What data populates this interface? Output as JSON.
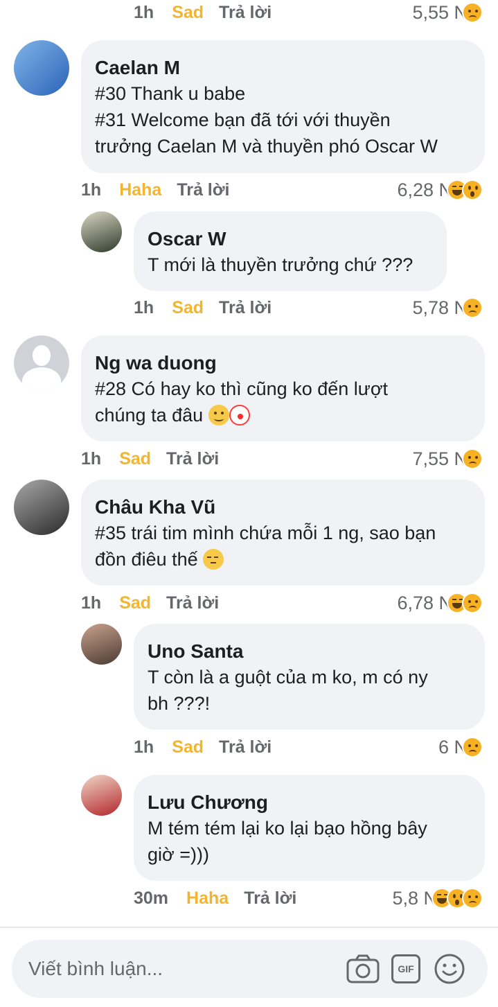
{
  "top_meta": {
    "time": "1h",
    "reaction": "Sad",
    "reply": "Trả lời",
    "count": "5,55 N",
    "emojis": [
      "sad"
    ]
  },
  "comments": [
    {
      "name": "Caelan M",
      "lines": [
        "#30 Thank u babe",
        "#31 Welcome bạn đã tới với thuyền",
        "trưởng Caelan M và thuyền phó Oscar W"
      ],
      "time": "1h",
      "reaction": "Haha",
      "reply": "Trả lời",
      "count": "6,28 N",
      "emojis": [
        "haha",
        "wow"
      ],
      "avatar_color": "#3f7fcf"
    },
    {
      "name": "Oscar W",
      "lines": [
        "T mới là thuyền trưởng chứ ???"
      ],
      "time": "1h",
      "reaction": "Sad",
      "reply": "Trả lời",
      "count": "5,78 N",
      "emojis": [
        "sad"
      ],
      "avatar_color": "#3b3f36"
    },
    {
      "name": "Ng wa duong",
      "lines": [
        "#28 Có hay ko thì cũng ko đến lượt",
        "chúng ta đâu"
      ],
      "line_emojis": [
        "smiling-face",
        "clown-face"
      ],
      "time": "1h",
      "reaction": "Sad",
      "reply": "Trả lời",
      "count": "7,55 N",
      "emojis": [
        "sad"
      ],
      "avatar_color": "#cfd3d8"
    },
    {
      "name": "Châu Kha Vũ",
      "lines": [
        "#35 trái tim mình chứa mỗi 1 ng, sao bạn",
        "đồn điêu thế"
      ],
      "line_emojis": [
        "pensive-face"
      ],
      "time": "1h",
      "reaction": "Sad",
      "reply": "Trả lời",
      "count": "6,78 N",
      "emojis": [
        "haha",
        "sad"
      ],
      "avatar_color": "#6b6b6b"
    },
    {
      "name": "Uno Santa",
      "lines": [
        "T còn là a guột của m ko, m có ny",
        "bh ???!"
      ],
      "time": "1h",
      "reaction": "Sad",
      "reply": "Trả lời",
      "count": "6 N",
      "emojis": [
        "sad"
      ],
      "avatar_color": "#8f5e4a"
    },
    {
      "name": "Lưu Chương",
      "lines": [
        "M tém tém lại ko lại bạo hồng bây",
        "giờ =)))"
      ],
      "time": "30m",
      "reaction": "Haha",
      "reply": "Trả lời",
      "count": "5,8 N",
      "emojis": [
        "haha",
        "wow",
        "sad"
      ],
      "avatar_color": "#c23a3a"
    }
  ],
  "composer": {
    "placeholder": "Viết bình luận...",
    "icons": [
      "camera-icon",
      "gif-icon",
      "emoji-icon"
    ],
    "gif_label": "GIF"
  },
  "colors": {
    "reaction_label": "#f2b530",
    "meta": "#65676b",
    "bubble": "#f0f2f5"
  }
}
